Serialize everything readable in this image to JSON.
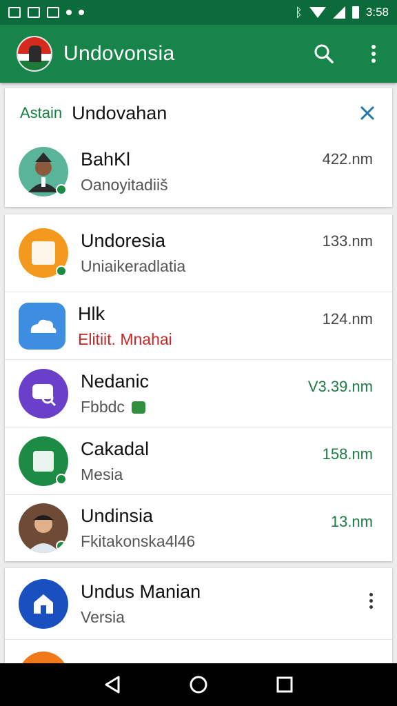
{
  "status_bar": {
    "time": "3:58"
  },
  "app_bar": {
    "title": "Undovonsia"
  },
  "header_card": {
    "label": "Astain",
    "title": "Undovahan",
    "contact": {
      "name": "BahKl",
      "subtitle": "Oanoyitadiiš",
      "time": "422.nm"
    }
  },
  "list": [
    {
      "name": "Undoresia",
      "subtitle": "Uniaikeradlatia",
      "time": "133.nm",
      "color": "#f39a1e",
      "icon": "document-icon"
    },
    {
      "name": "Hlk",
      "subtitle": "Elitiit. Mnahai",
      "time": "124.nm",
      "color": "#3d8ee0",
      "icon": "cloud-icon"
    },
    {
      "name": "Nedanic",
      "subtitle": "Fbbdc",
      "time": "V3.39.nm",
      "color": "#6a3fc9",
      "icon": "chat-search-icon"
    },
    {
      "name": "Cakadal",
      "subtitle": "Mesia",
      "time": "158.nm",
      "color": "#1c8c45",
      "icon": "app-icon"
    },
    {
      "name": "Undinsia",
      "subtitle": "Fkitakonska4l46",
      "time": "13.nm",
      "color": "#6d4b36",
      "icon": "person-photo"
    }
  ],
  "bottom_card": {
    "name": "Undus Manian",
    "subtitle": "Versia",
    "color": "#1a4fc0",
    "icon": "home-icon",
    "next_color": "#f07a1a"
  },
  "nav": {
    "back": "back-icon",
    "home": "home-circle-icon",
    "recents": "recents-icon"
  },
  "colors": {
    "status_bar": "#0c6b3b",
    "app_bar": "#17854a",
    "accent": "#12813f"
  }
}
